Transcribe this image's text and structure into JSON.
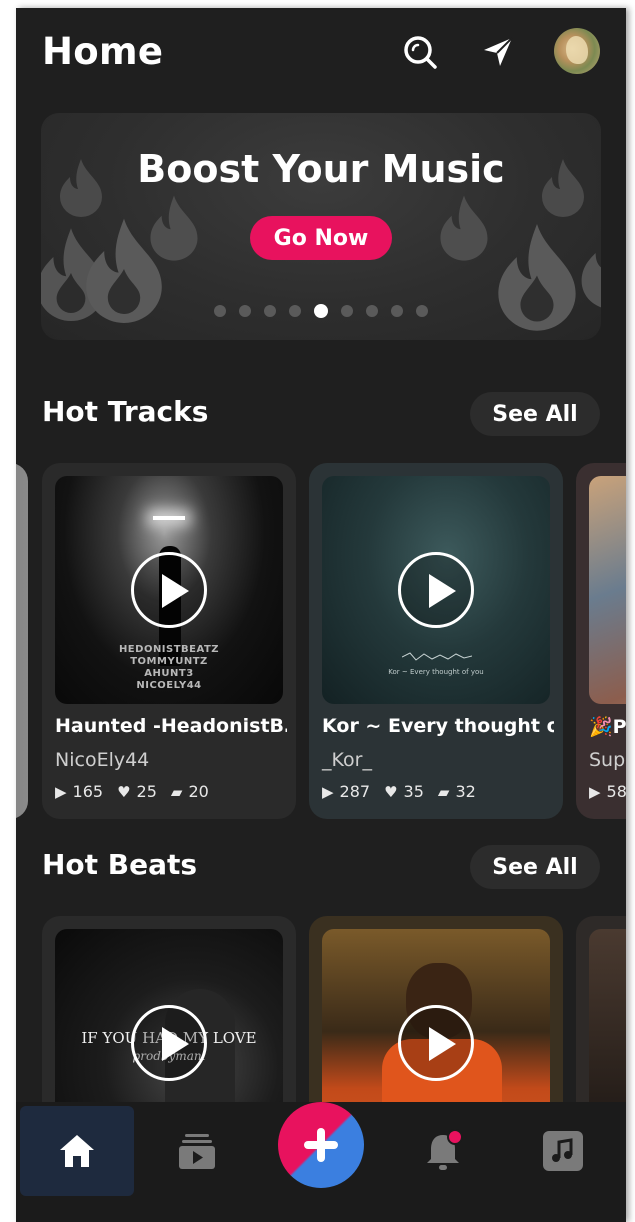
{
  "header": {
    "title": "Home",
    "icons": [
      "search-icon",
      "send-icon",
      "avatar"
    ]
  },
  "banner": {
    "title": "Boost Your Music",
    "button_label": "Go Now",
    "slides_total": 9,
    "active_slide": 5
  },
  "hot_tracks": {
    "title": "Hot Tracks",
    "see_all_label": "See All",
    "items": [
      {
        "title": "Haunted -HeadonistB…",
        "artist": "NicoEly44",
        "plays": "165",
        "likes": "25",
        "comments": "20",
        "cover_lines": [
          "HEDONISTBEATZ",
          "TOMMYUNTZ",
          "AHUNT3",
          "NICOELY44"
        ]
      },
      {
        "title": "Kor ~ Every thought o…",
        "artist": "_Kor_",
        "plays": "287",
        "likes": "35",
        "comments": "32",
        "cover_caption": "Kor ~ Every thought of you"
      },
      {
        "title": "🎉P",
        "artist": "Sup",
        "plays": "58"
      }
    ]
  },
  "hot_beats": {
    "title": "Hot Beats",
    "see_all_label": "See All",
    "items": [
      {
        "cover_line1": "IF YOU HAD MY LOVE",
        "cover_line2": "prodbymani"
      },
      {}
    ]
  },
  "bottom_nav": {
    "items": [
      "home-icon",
      "feed-icon",
      "add-icon",
      "notification-icon",
      "music-library-icon"
    ],
    "active": "home-icon"
  },
  "colors": {
    "accent": "#e8125e",
    "blue": "#3b7fe0",
    "background": "#1f1f1f"
  }
}
